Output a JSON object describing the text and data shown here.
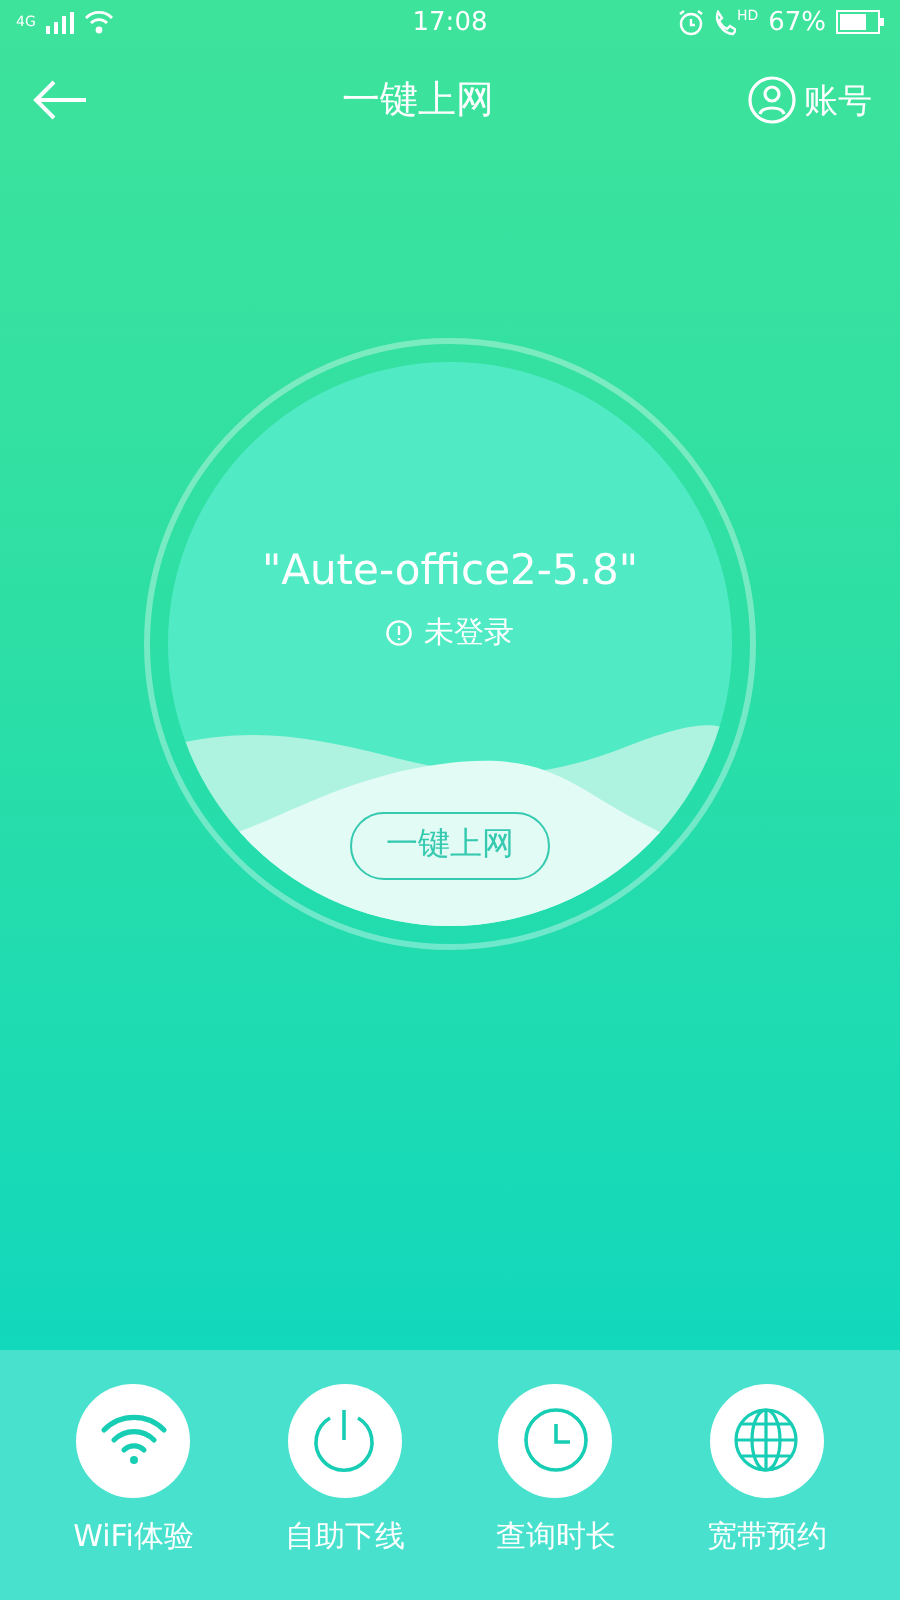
{
  "status_bar": {
    "network": "4G",
    "time": "17:08",
    "call_badge": "HD",
    "battery": "67%"
  },
  "header": {
    "title": "一键上网",
    "account": "账号"
  },
  "connection": {
    "ssid": "\"Aute-office2-5.8\"",
    "status": "未登录",
    "button": "一键上网"
  },
  "actions": [
    {
      "kind": "wifi",
      "label": "WiFi体验"
    },
    {
      "kind": "power",
      "label": "自助下线"
    },
    {
      "kind": "clock",
      "label": "查询时长"
    },
    {
      "kind": "globe",
      "label": "宽带预约"
    }
  ]
}
